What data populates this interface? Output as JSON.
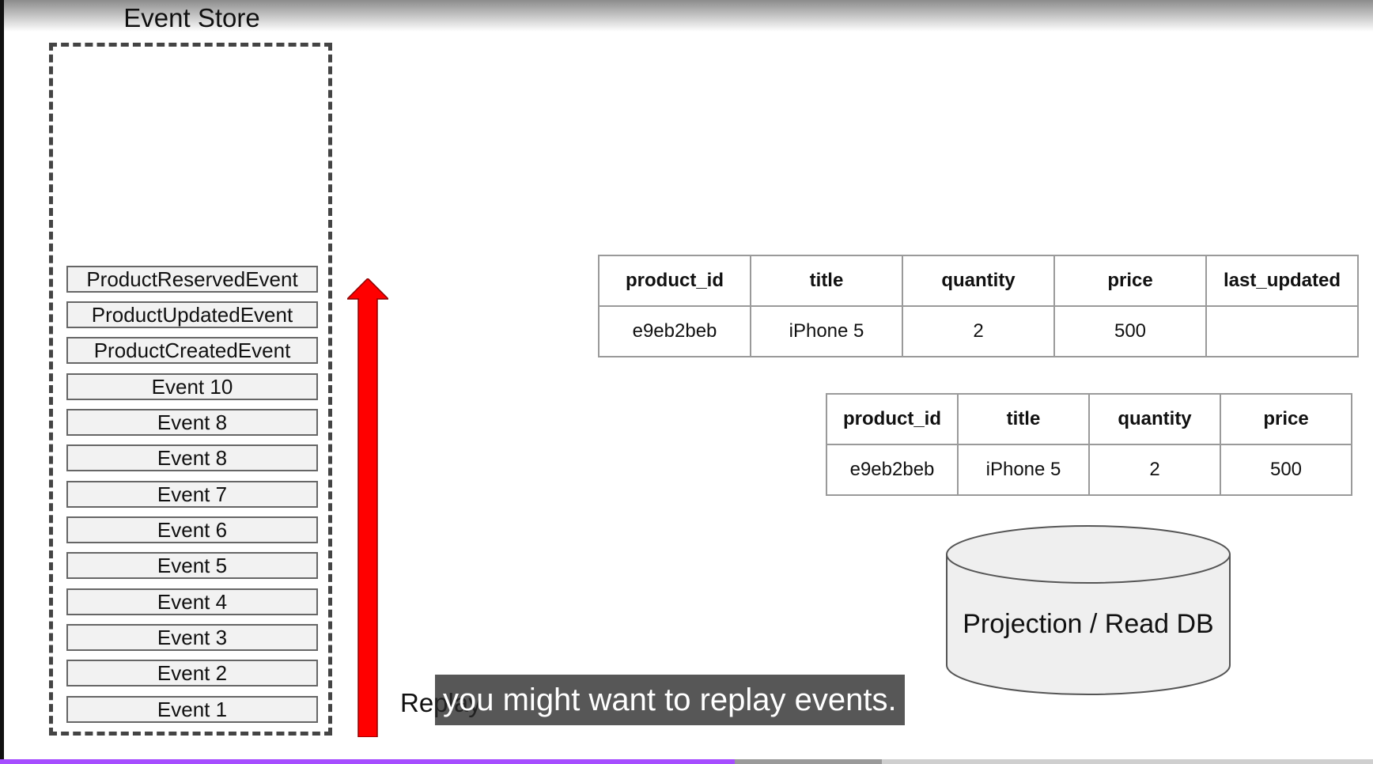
{
  "event_store": {
    "title": "Event Store",
    "events": [
      "ProductReservedEvent",
      "ProductUpdatedEvent",
      "ProductCreatedEvent",
      "Event 10",
      "Event 8",
      "Event 8",
      "Event 7",
      "Event 6",
      "Event 5",
      "Event 4",
      "Event 3",
      "Event 2",
      "Event 1"
    ]
  },
  "replay": {
    "label": "Replay",
    "arrow_color": "#ff0000"
  },
  "table_a": {
    "headers": [
      "product_id",
      "title",
      "quantity",
      "price",
      "last_updated"
    ],
    "rows": [
      [
        "e9eb2beb",
        "iPhone 5",
        "2",
        "500",
        ""
      ]
    ]
  },
  "table_b": {
    "headers": [
      "product_id",
      "title",
      "quantity",
      "price"
    ],
    "rows": [
      [
        "e9eb2beb",
        "iPhone 5",
        "2",
        "500"
      ]
    ]
  },
  "database": {
    "label": "Projection / Read DB",
    "fill": "#efefef"
  },
  "subtitle": "you might want to replay events.",
  "video_progress": {
    "played_fraction": 0.535,
    "buffered_fraction": 0.642,
    "played_color": "#a64dff"
  }
}
